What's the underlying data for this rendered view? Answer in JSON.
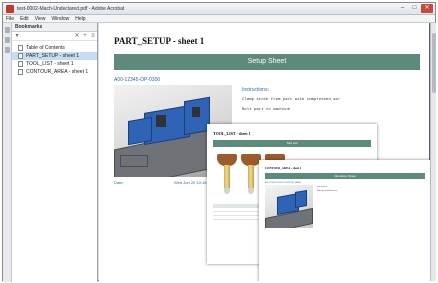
{
  "window": {
    "title": "test-0002-Mach-Undeclared.pdf - Adobe Acrobat",
    "controls": {
      "minimize": "–",
      "maximize": "□",
      "close": "✕"
    }
  },
  "menubar": {
    "items": [
      "File",
      "Edit",
      "View",
      "Window",
      "Help"
    ]
  },
  "bookmarks": {
    "header": "Bookmarks",
    "items": [
      {
        "label": "Table of Contents",
        "selected": false
      },
      {
        "label": "PART_SETUP - sheet 1",
        "selected": true
      },
      {
        "label": "TOOL_LIST - sheet 1",
        "selected": false
      },
      {
        "label": "CONTOUR_AREA - sheet 1",
        "selected": false
      }
    ]
  },
  "page_setup": {
    "title": "PART_SETUP - sheet 1",
    "banner": "Setup Sheet",
    "part_number": "A00-12345-OP-0300",
    "instructions_title": "Instructions:",
    "instructions": [
      "Clamp stock from part with compressed air",
      "Bolt part to machine"
    ],
    "footer_left": "Date:",
    "footer_right": "Wed Jun 20 10:15:19 2018"
  },
  "page_tools": {
    "title": "TOOL_LIST - sheet 1",
    "banner": "Tool List"
  },
  "page_operation": {
    "title": "CONTOUR_AREA - sheet 1",
    "banner": "Operation Sheet",
    "part_number": "A00-12345-OP-0300 CONTOUR_AREA",
    "instructions_title": "Instructions:",
    "instructions_line": "Run op, check first cut"
  },
  "colors": {
    "banner": "#5e8a7d",
    "part_blue": "#2e63b5",
    "link_blue": "#2f6aa8",
    "tool_holder": "#9c5b2a"
  }
}
